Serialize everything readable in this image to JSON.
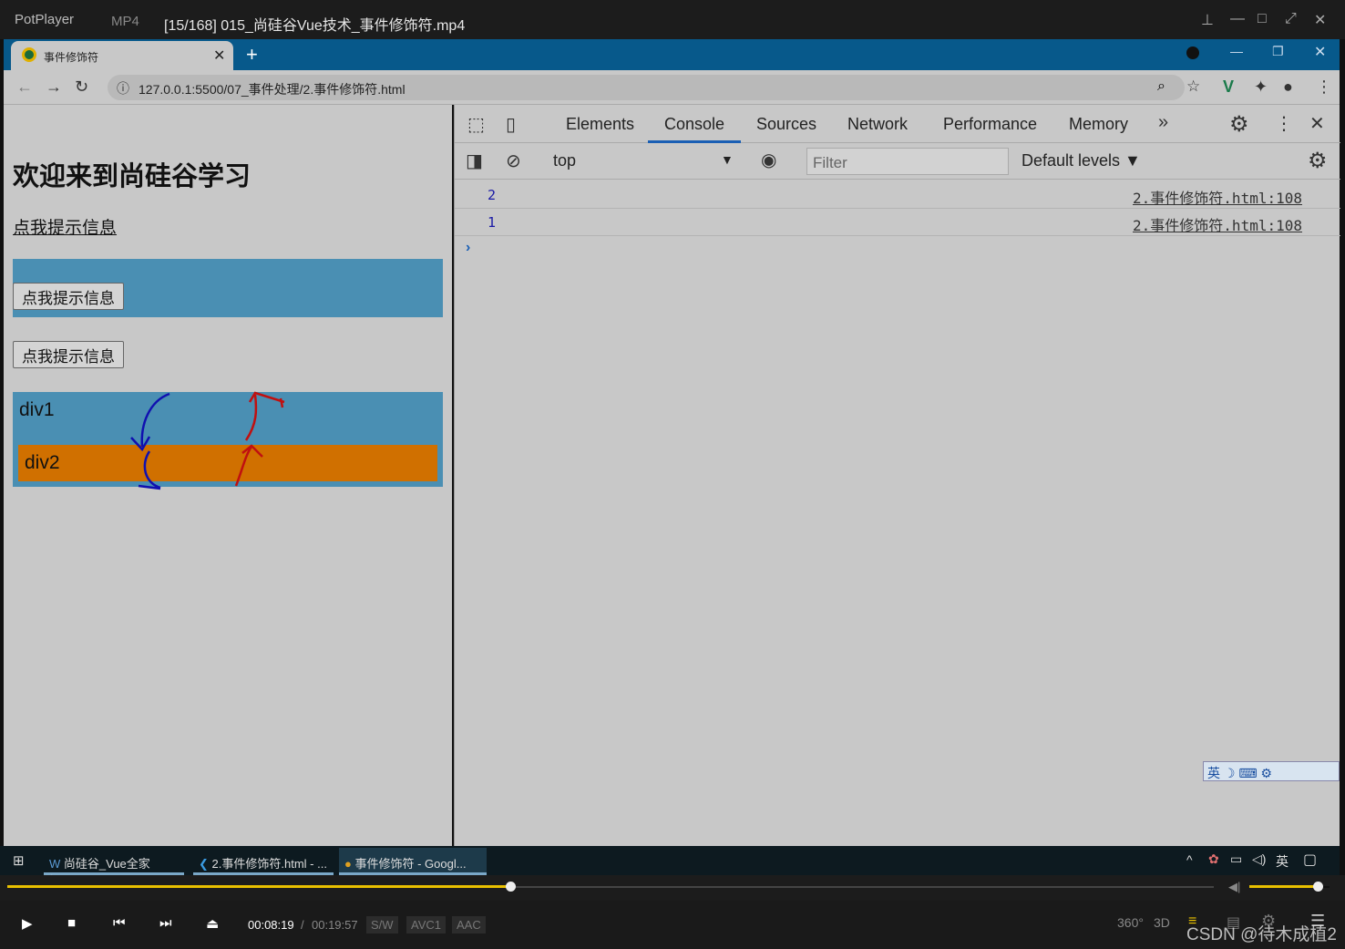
{
  "player": {
    "app": "PotPlayer",
    "format": "MP4",
    "title": "[15/168] 015_尚硅谷Vue技术_事件修饰符.mp4",
    "current_time": "00:08:19",
    "total_time": "00:19:57",
    "tags": [
      "S/W",
      "AVC1",
      "AAC"
    ],
    "progress_percent": 41.7,
    "volume_percent": 85,
    "extra_icons": [
      "360°",
      "3D"
    ],
    "watermark": "CSDN @待木成植2"
  },
  "browser": {
    "tab_title": "事件修饰符",
    "url": "127.0.0.1:5500/07_事件处理/2.事件修饰符.html"
  },
  "page": {
    "heading": "欢迎来到尚硅谷学习",
    "link": "点我提示信息",
    "button1": "点我提示信息",
    "button2": "点我提示信息",
    "div1": "div1",
    "div2": "div2",
    "colors": {
      "box": "#4a8fb3",
      "div2": "#d07000",
      "capture_arrow": "#1010b0",
      "bubble_arrow": "#c01010"
    }
  },
  "devtools": {
    "tabs": [
      "Elements",
      "Console",
      "Sources",
      "Network",
      "Performance",
      "Memory"
    ],
    "active_tab": "Console",
    "context": "top",
    "filter_placeholder": "Filter",
    "levels": "Default levels ▼",
    "logs": [
      {
        "value": "2",
        "source": "2.事件修饰符.html:108"
      },
      {
        "value": "1",
        "source": "2.事件修饰符.html:108"
      }
    ]
  },
  "ime": "英",
  "taskbar": {
    "items": [
      "尚硅谷_Vue全家桶.d...",
      "2.事件修饰符.html - ...",
      "事件修饰符 - Googl..."
    ],
    "tray_lang": "英"
  }
}
